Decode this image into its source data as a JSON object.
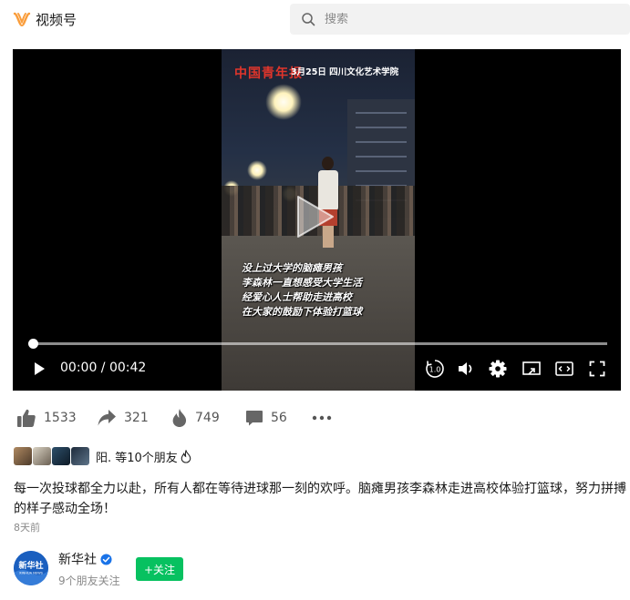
{
  "header": {
    "logo_text": "视频号",
    "logo_color": "#fa9d3b",
    "search_placeholder": "搜索"
  },
  "video": {
    "overlay_brand": "中国青年报",
    "overlay_date": "3月25日 四川文化艺术学院",
    "captions": [
      "没上过大学的脑瘫男孩",
      "李森林一直想感受大学生活",
      "经爱心人士帮助走进高校",
      "在大家的鼓励下体验打篮球"
    ],
    "time_display": "00:00 / 00:42",
    "progress_fraction": 0.0,
    "speed_label": "1.0"
  },
  "actions": {
    "likes": "1533",
    "shares": "321",
    "hearts": "749",
    "comments": "56"
  },
  "friends": {
    "text": "阳. 等10个朋友"
  },
  "description": "每一次投球都全力以赴，所有人都在等待进球那一刻的欢呼。脑瘫男孩李森林走进高校体验打篮球，努力拼搏的样子感动全场！",
  "posted": "8天前",
  "author": {
    "name": "新华社",
    "avatar_text": "新华社",
    "avatar_sub": "XINHUA NEWS",
    "sub": "9个朋友关注",
    "follow_label": "+关注",
    "verified_color": "#1a73e8",
    "follow_color": "#07c160"
  }
}
